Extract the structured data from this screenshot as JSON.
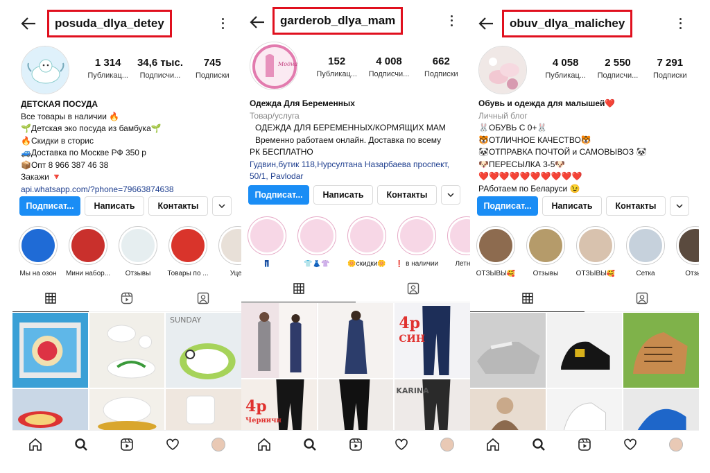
{
  "profiles": [
    {
      "username": "posuda_dlya_detey",
      "stats": [
        {
          "value": "1 314",
          "label": "Публикац..."
        },
        {
          "value": "34,6 тыс.",
          "label": "Подписчи..."
        },
        {
          "value": "745",
          "label": "Подписки"
        }
      ],
      "bio": [
        "ДЕТСКАЯ ПОСУДА",
        "Все товары в наличии 🔥",
        "🌱Детская эко посуда из бамбука🌱",
        "🔥Скидки в сторис",
        "🚙Доставка по Москве РФ 350 р",
        "📦Опт 8 966 387 46 38",
        "Закажи 🔻",
        "api.whatsapp.com/?phone=79663874638"
      ],
      "buttons": {
        "follow": "Подписат...",
        "message": "Написать",
        "contacts": "Контакты"
      },
      "highlights": [
        "Мы на озон",
        "Мини набор...",
        "Отзывы",
        "Товары по ...",
        "Уцен"
      ],
      "highlight_colors": [
        "#1f6bd6",
        "#c9302c",
        "#e6eef0",
        "#d9342b",
        "#e8e0d8"
      ]
    },
    {
      "username": "garderob_dlya_mam",
      "stats": [
        {
          "value": "152",
          "label": "Публикац..."
        },
        {
          "value": "4 008",
          "label": "Подписчи..."
        },
        {
          "value": "662",
          "label": "Подписки"
        }
      ],
      "bio": [
        "Одежда Для Беременных",
        "Товар/услуга",
        "ОДЕЖДА ДЛЯ БЕРЕМЕННЫХ/КОРМЯЩИХ МАМ",
        "Временно работаем онлайн.  Доставка по всему",
        "РК БЕСПЛАТНО",
        "Гудвин,бутик 118,Нурсултана Назарбаева проспект,",
        "50/1, Pavlodar"
      ],
      "avatar_text": "Модная мама",
      "buttons": {
        "follow": "Подписат...",
        "message": "Написать",
        "contacts": "Контакты"
      },
      "highlights": [
        "👖",
        "👕👗👚",
        "🌼скидки🌼",
        "❗ в наличии",
        "Летние"
      ],
      "highlight_colors": [
        "#f3c1d7",
        "#f3c1d7",
        "#f3c1d7",
        "#f3c1d7",
        "#f3c1d7"
      ],
      "tile_texts": [
        "4р",
        "СИН",
        "4р",
        "Черничн",
        "KARINA"
      ]
    },
    {
      "username": "obuv_dlya_malichey",
      "stats": [
        {
          "value": "4 058",
          "label": "Публикац..."
        },
        {
          "value": "2 550",
          "label": "Подписчи..."
        },
        {
          "value": "7 291",
          "label": "Подписки"
        }
      ],
      "bio": [
        "Обувь и одежда для малышей❤️",
        "Личный блог",
        "🐰ОБУВЬ С 0+🐰",
        "🐯ОТЛИЧНОЕ КАЧЕСТВО🐯",
        "🐼ОТПРАВКА ПОЧТОЙ и САМОВЫВОЗ 🐼",
        "🐶ПЕРЕСЫЛКА 3-5🐶",
        "❤️❤️❤️❤️❤️❤️❤️❤️❤️❤️",
        "РАботаем по Беларуси 😉"
      ],
      "buttons": {
        "follow": "Подписат...",
        "message": "Написать",
        "contacts": "Контакты"
      },
      "highlights": [
        "ОТЗЫВЫ🥰",
        "Отзывы",
        "ОТЗЫВЫ🥰",
        "Сетка",
        "Отзыв"
      ],
      "highlight_colors": [
        "#8d6b4f",
        "#b59b6a",
        "#d8c2ae",
        "#c6d1dc",
        "#5a4a3e"
      ]
    }
  ]
}
